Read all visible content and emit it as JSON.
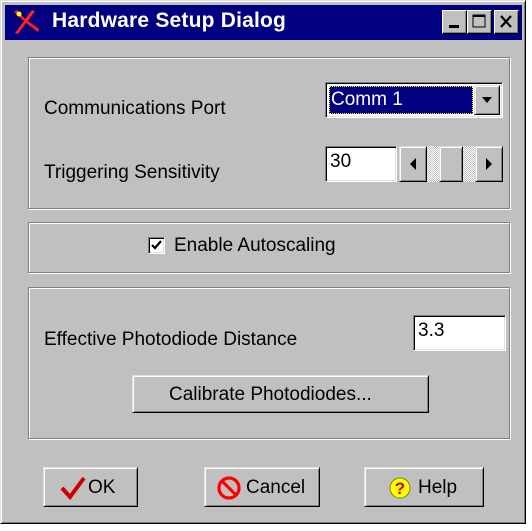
{
  "window": {
    "title": "Hardware Setup Dialog",
    "title_bar_color": "#000080",
    "face_color": "#c0c0c0",
    "app_icon": "red-bird-icon",
    "caption_buttons": [
      "minimize-icon",
      "maximize-icon",
      "close-icon"
    ]
  },
  "port": {
    "label": "Communications Port",
    "selected": "Comm 1"
  },
  "sensitivity": {
    "label": "Triggering Sensitivity",
    "value": "30",
    "scroll_level": 0.5
  },
  "autoscale": {
    "label": "Enable Autoscaling",
    "checked": true
  },
  "photodiode": {
    "label": "Effective Photodiode Distance",
    "value": "3.3",
    "calibrate_label": "Calibrate Photodiodes..."
  },
  "buttons": {
    "ok": {
      "label": "OK",
      "icon": "checkmark-icon",
      "icon_color": "#cc0000"
    },
    "cancel": {
      "label": "Cancel",
      "icon": "prohibit-icon",
      "icon_color": "#ff0000"
    },
    "help": {
      "label": "Help",
      "icon": "question-icon",
      "icon_color": "#ffff00"
    }
  }
}
